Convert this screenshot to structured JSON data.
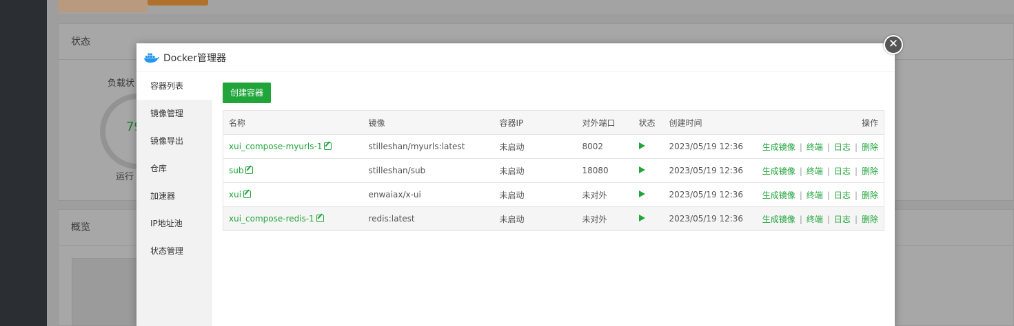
{
  "background": {
    "status_title": "状态",
    "overview_title": "概览",
    "load_label": "负载状",
    "ring_value": "79",
    "running_label": "运行"
  },
  "modal": {
    "title": "Docker管理器",
    "close_symbol": "✕",
    "sidebar": [
      {
        "label": "容器列表",
        "active": true
      },
      {
        "label": "镜像管理"
      },
      {
        "label": "镜像导出"
      },
      {
        "label": "仓库"
      },
      {
        "label": "加速器"
      },
      {
        "label": "IP地址池"
      },
      {
        "label": "状态管理"
      }
    ],
    "create_button": "创建容器",
    "table": {
      "headers": [
        "名称",
        "镜像",
        "容器IP",
        "对外端口",
        "状态",
        "创建时间",
        "操作"
      ],
      "rows": [
        {
          "name": "xui_compose-myurls-1",
          "image": "stilleshan/myurls:latest",
          "ip": "未启动",
          "port": "8002",
          "time": "2023/05/19 12:36"
        },
        {
          "name": "sub",
          "image": "stilleshan/sub",
          "ip": "未启动",
          "port": "18080",
          "time": "2023/05/19 12:36"
        },
        {
          "name": "xui",
          "image": "enwaiax/x-ui",
          "ip": "未启动",
          "port": "未对外",
          "time": "2023/05/19 12:36"
        },
        {
          "name": "xui_compose-redis-1",
          "image": "redis:latest",
          "ip": "未启动",
          "port": "未对外",
          "time": "2023/05/19 12:36"
        }
      ],
      "actions": [
        "生成镜像",
        "终端",
        "日志",
        "删除"
      ],
      "action_separator": "|"
    }
  },
  "colors": {
    "accent": "#20a53a",
    "danger": "#ef0808"
  }
}
